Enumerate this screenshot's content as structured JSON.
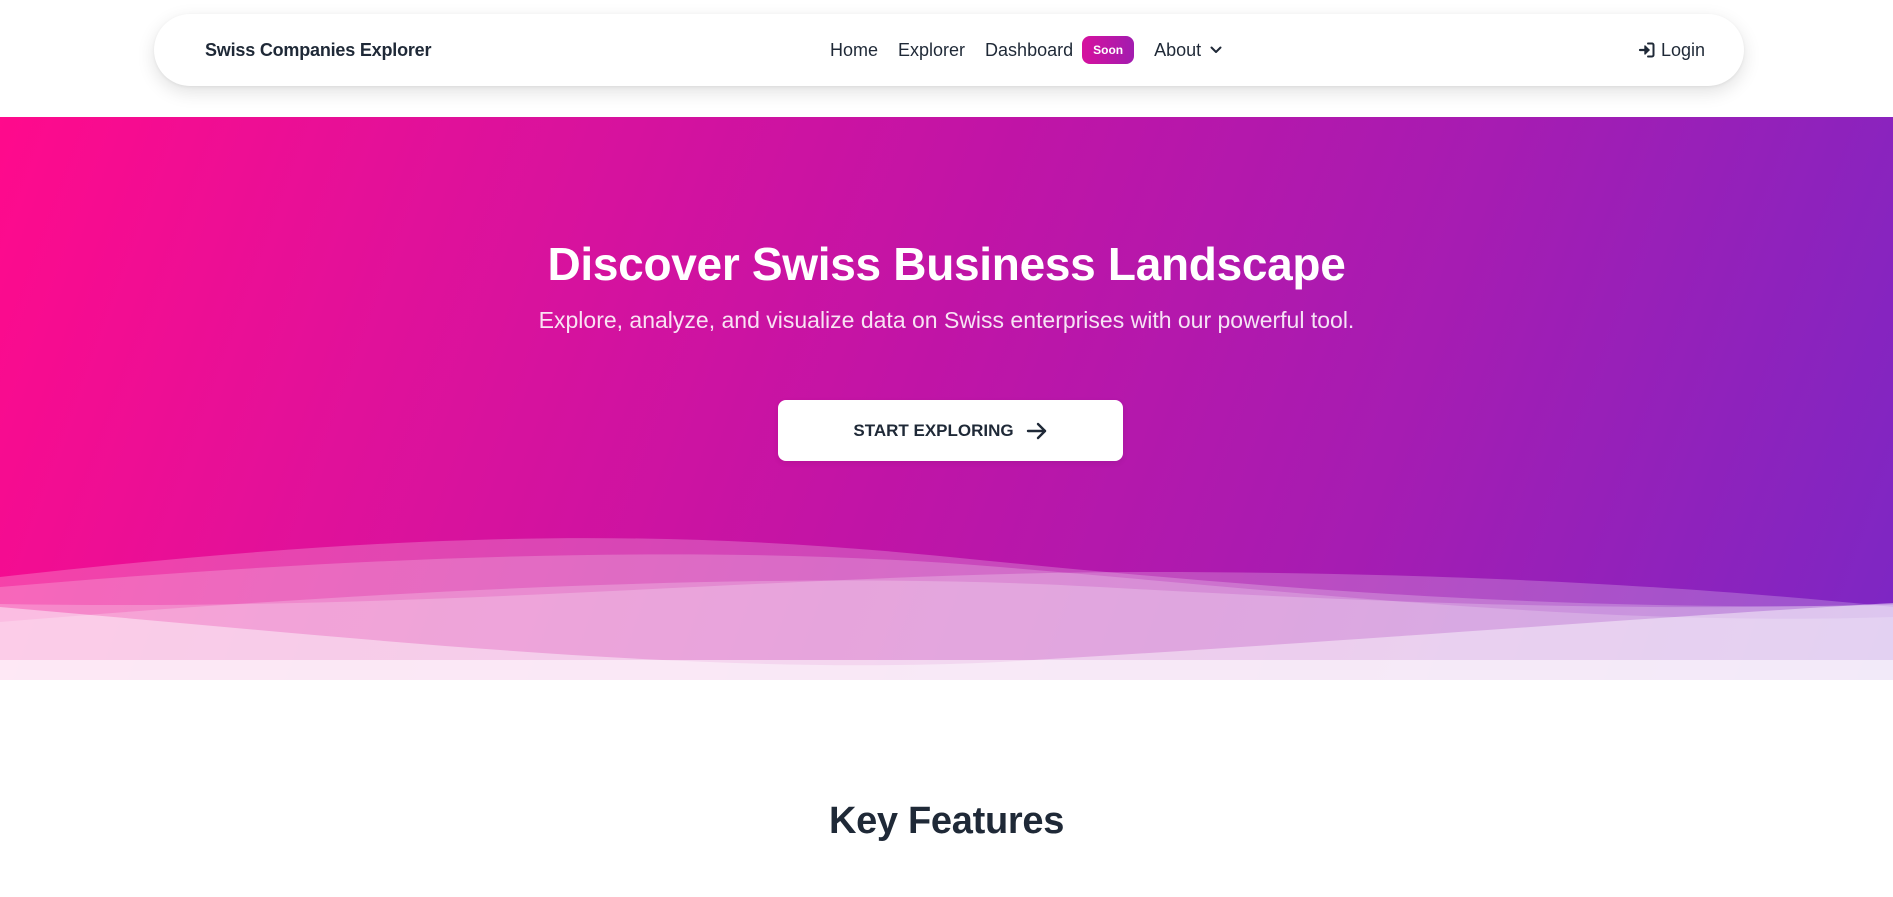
{
  "navbar": {
    "brand": "Swiss Companies Explorer",
    "links": {
      "home": "Home",
      "explorer": "Explorer",
      "dashboard": "Dashboard",
      "dashboard_badge": "Soon",
      "about": "About"
    },
    "login": "Login",
    "icons": {
      "about_dropdown": "chevron-down-icon",
      "login": "sign-in-icon"
    }
  },
  "hero": {
    "title": "Discover Swiss Business Landscape",
    "subtitle": "Explore, analyze, and visualize data on Swiss enterprises with our powerful tool.",
    "cta_label": "START EXPLORING",
    "cta_icon": "arrow-right-icon"
  },
  "features": {
    "title": "Key Features"
  },
  "colors": {
    "gradient_start": "#ff0a8c",
    "gradient_mid": "#c114a6",
    "gradient_end": "#7c27c4",
    "badge": "#c8129f",
    "text_dark": "#1f2937"
  }
}
